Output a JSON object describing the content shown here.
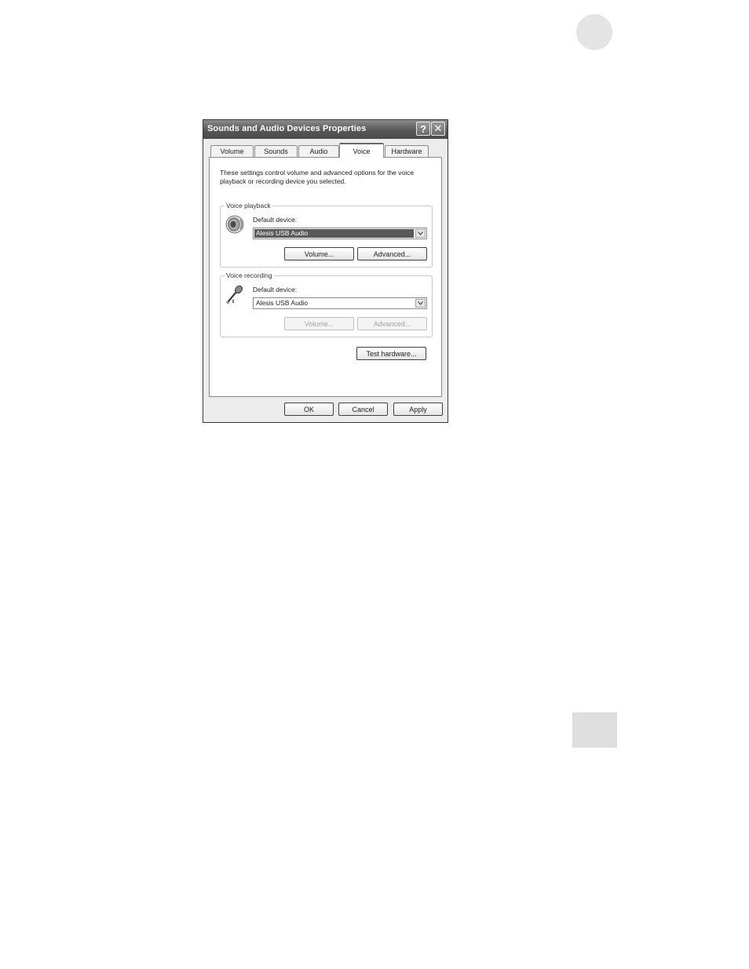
{
  "dialog": {
    "title": "Sounds and Audio Devices Properties",
    "help_glyph": "?",
    "close_glyph": "✕"
  },
  "tabs": [
    {
      "label": "Volume",
      "active": false
    },
    {
      "label": "Sounds",
      "active": false
    },
    {
      "label": "Audio",
      "active": false
    },
    {
      "label": "Voice",
      "active": true
    },
    {
      "label": "Hardware",
      "active": false
    }
  ],
  "voice_tab": {
    "description": "These settings control volume and advanced options for the voice playback or recording device you selected.",
    "playback": {
      "group_label": "Voice playback",
      "device_label": "Default device:",
      "device_value": "Alesis USB Audio",
      "volume_button": "Volume...",
      "advanced_button": "Advanced...",
      "icon": "speaker-icon"
    },
    "recording": {
      "group_label": "Voice recording",
      "device_label": "Default device:",
      "device_value": "Alesis USB Audio",
      "volume_button": "Volume...",
      "advanced_button": "Advanced...",
      "icon": "microphone-icon"
    },
    "test_hardware_button": "Test hardware..."
  },
  "footer": {
    "ok": "OK",
    "cancel": "Cancel",
    "apply": "Apply"
  },
  "colors": {
    "titlebar": "#575757",
    "selection": "#5a5a5a",
    "page_marks": "#e4e4e4"
  }
}
